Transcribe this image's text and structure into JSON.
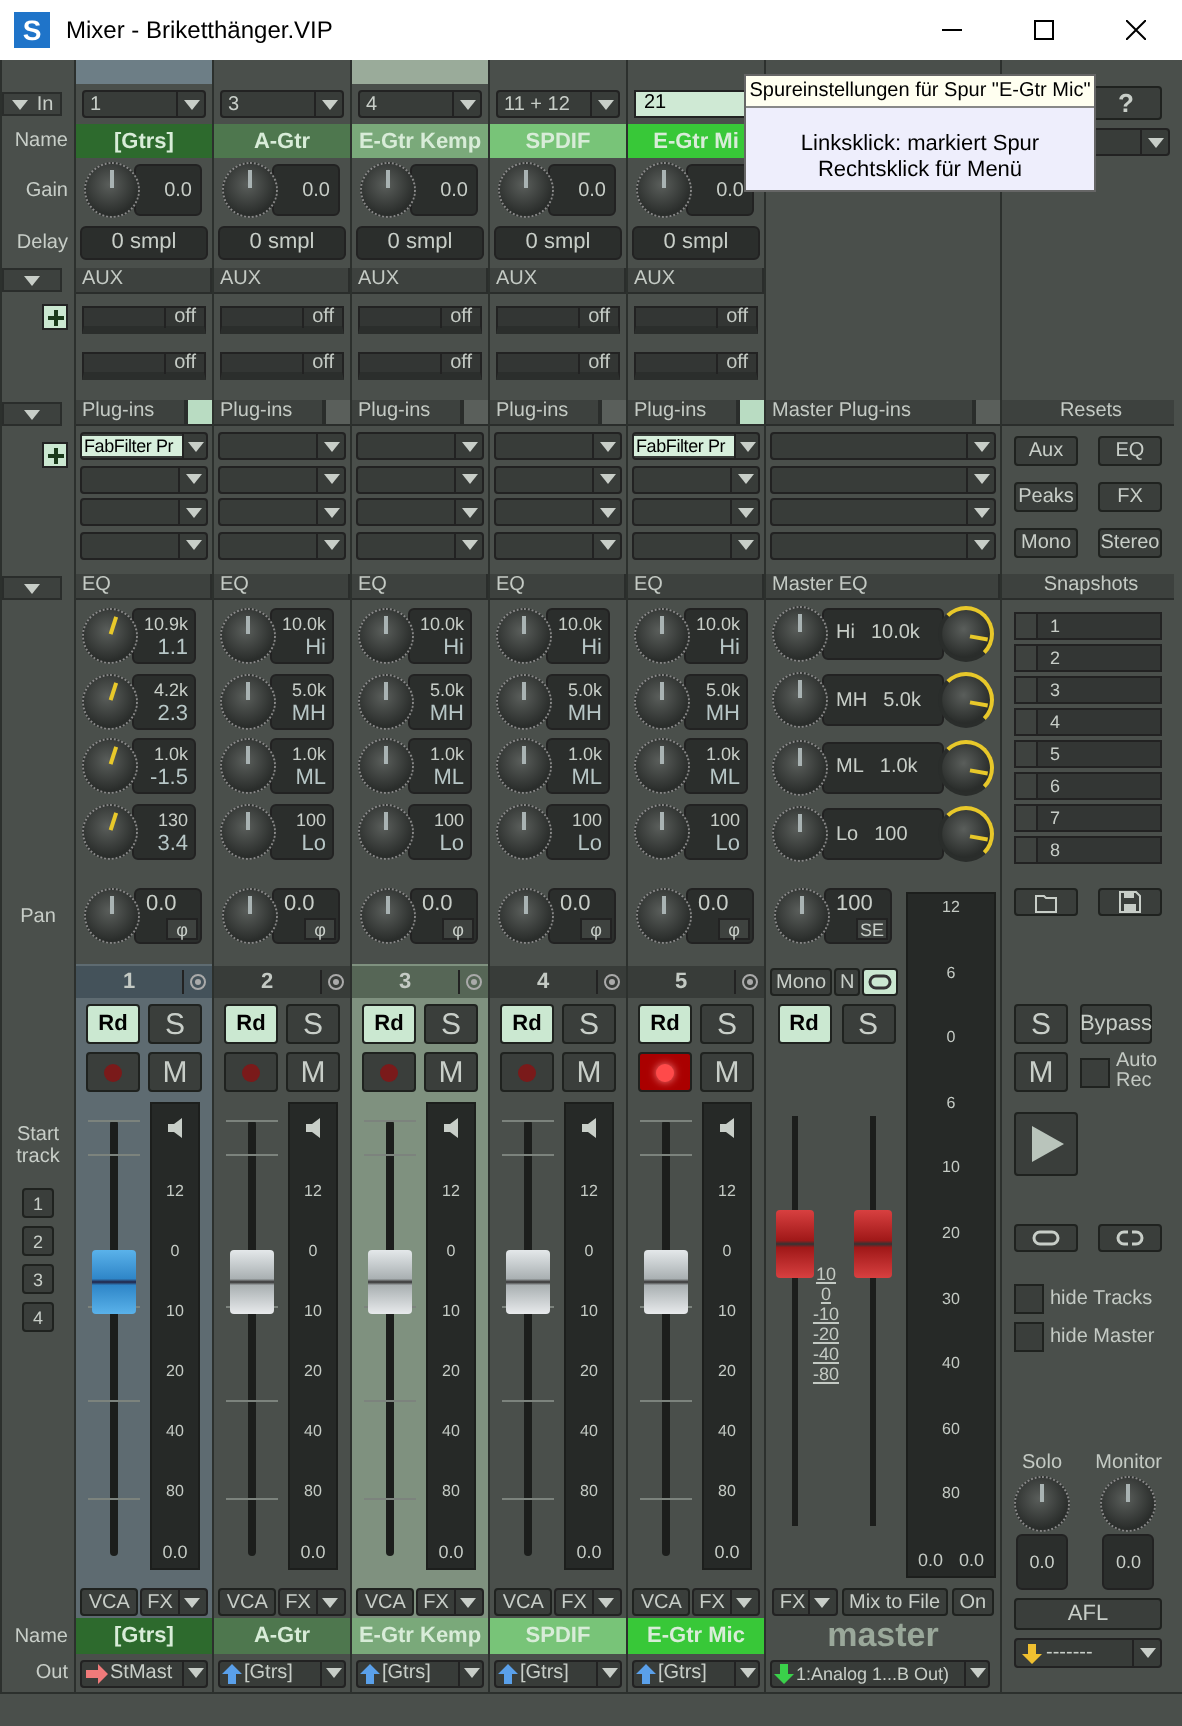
{
  "window": {
    "logo": "S",
    "title": "Mixer - Briketthänger.VIP"
  },
  "row_labels": {
    "in": "In",
    "name": "Name",
    "gain": "Gain",
    "delay": "Delay",
    "pan": "Pan",
    "start_track": "Start track",
    "name_bottom": "Name",
    "out": "Out"
  },
  "start_track_buttons": [
    "1",
    "2",
    "3",
    "4"
  ],
  "channels": [
    {
      "selected": true,
      "hovered": false,
      "input": "1",
      "input_editing": false,
      "name": "[Gtrs]",
      "name_bottom": "[Gtrs]",
      "color": "#2d6a2d",
      "gain": "0.0",
      "delay": "0 smpl",
      "aux_label": "AUX",
      "aux": [
        "off",
        "off"
      ],
      "plugins_label": "Plug-ins",
      "plugins_active": true,
      "plugins": [
        "FabFilter Pr"
      ],
      "eq_label": "EQ",
      "eq": [
        {
          "freq": "10.9k",
          "value": "1.1",
          "active": true
        },
        {
          "freq": "4.2k",
          "value": "2.3",
          "active": true
        },
        {
          "freq": "1.0k",
          "value": "-1.5",
          "active": true
        },
        {
          "freq": "130",
          "value": "3.4",
          "active": true
        }
      ],
      "pan": "0.0",
      "phase": "φ",
      "number": "1",
      "read": "Rd",
      "read_on": true,
      "solo": "S",
      "solo_on": false,
      "rec_armed": false,
      "mute": "M",
      "mute_on": false,
      "level": 0.62,
      "meter_scale": [
        "12",
        "0",
        "10",
        "20",
        "40",
        "80"
      ],
      "meter_value": "0.0",
      "vca": "VCA",
      "fx": "FX",
      "out": {
        "kind": "right",
        "value": "StMast"
      }
    },
    {
      "selected": false,
      "hovered": false,
      "input": "3",
      "input_editing": false,
      "name": "A-Gtr",
      "name_bottom": "A-Gtr",
      "color": "#4e774e",
      "gain": "0.0",
      "delay": "0 smpl",
      "aux_label": "AUX",
      "aux": [
        "off",
        "off"
      ],
      "plugins_label": "Plug-ins",
      "plugins_active": false,
      "eq_label": "EQ",
      "eq": [
        {
          "freq": "10.0k",
          "value": "Hi",
          "active": false
        },
        {
          "freq": "5.0k",
          "value": "MH",
          "active": false
        },
        {
          "freq": "1.0k",
          "value": "ML",
          "active": false
        },
        {
          "freq": "100",
          "value": "Lo",
          "active": false
        }
      ],
      "pan": "0.0",
      "phase": "φ",
      "number": "2",
      "read": "Rd",
      "read_on": true,
      "solo": "S",
      "solo_on": false,
      "rec_armed": false,
      "mute": "M",
      "mute_on": false,
      "level": 0.62,
      "meter_scale": [
        "12",
        "0",
        "10",
        "20",
        "40",
        "80"
      ],
      "meter_value": "0.0",
      "vca": "VCA",
      "fx": "FX",
      "out": {
        "kind": "up",
        "value": "[Gtrs]"
      }
    },
    {
      "selected": false,
      "hovered": true,
      "input": "4",
      "input_editing": false,
      "name": "E-Gtr Kemp",
      "name_bottom": "E-Gtr Kemp",
      "color": "#7aa97a",
      "gain": "0.0",
      "delay": "0 smpl",
      "aux_label": "AUX",
      "aux": [
        "off",
        "off"
      ],
      "plugins_label": "Plug-ins",
      "plugins_active": false,
      "eq_label": "EQ",
      "eq": [
        {
          "freq": "10.0k",
          "value": "Hi",
          "active": false
        },
        {
          "freq": "5.0k",
          "value": "MH",
          "active": false
        },
        {
          "freq": "1.0k",
          "value": "ML",
          "active": false
        },
        {
          "freq": "100",
          "value": "Lo",
          "active": false
        }
      ],
      "pan": "0.0",
      "phase": "φ",
      "number": "3",
      "read": "Rd",
      "read_on": true,
      "solo": "S",
      "solo_on": false,
      "rec_armed": false,
      "mute": "M",
      "mute_on": false,
      "level": 0.62,
      "meter_scale": [
        "12",
        "0",
        "10",
        "20",
        "40",
        "80"
      ],
      "meter_value": "0.0",
      "vca": "VCA",
      "fx": "FX",
      "out": {
        "kind": "up",
        "value": "[Gtrs]"
      }
    },
    {
      "selected": false,
      "hovered": false,
      "input": "11 + 12",
      "input_editing": false,
      "name": "SPDIF",
      "name_bottom": "SPDIF",
      "color": "#78c478",
      "gain": "0.0",
      "delay": "0 smpl",
      "aux_label": "AUX",
      "aux": [
        "off",
        "off"
      ],
      "plugins_label": "Plug-ins",
      "plugins_active": false,
      "eq_label": "EQ",
      "eq": [
        {
          "freq": "10.0k",
          "value": "Hi",
          "active": false
        },
        {
          "freq": "5.0k",
          "value": "MH",
          "active": false
        },
        {
          "freq": "1.0k",
          "value": "ML",
          "active": false
        },
        {
          "freq": "100",
          "value": "Lo",
          "active": false
        }
      ],
      "pan": "0.0",
      "phase": "φ",
      "number": "4",
      "read": "Rd",
      "read_on": true,
      "solo": "S",
      "solo_on": false,
      "rec_armed": false,
      "mute": "M",
      "mute_on": false,
      "level": 0.62,
      "meter_scale": [
        "12",
        "0",
        "10",
        "20",
        "40",
        "80"
      ],
      "meter_value": "0.0",
      "vca": "VCA",
      "fx": "FX",
      "out": {
        "kind": "up",
        "value": "[Gtrs]"
      }
    },
    {
      "selected": false,
      "hovered": false,
      "input": "21",
      "input_editing": true,
      "name": "E-Gtr Mi",
      "name_bottom": "E-Gtr Mic",
      "color": "#38c838",
      "gain": "0.0",
      "delay": "0 smpl",
      "aux_label": "AUX",
      "aux": [
        "off",
        "off"
      ],
      "plugins_label": "Plug-ins",
      "plugins_active": true,
      "plugins": [
        "FabFilter Pr"
      ],
      "eq_label": "EQ",
      "eq": [
        {
          "freq": "10.0k",
          "value": "Hi",
          "active": false
        },
        {
          "freq": "5.0k",
          "value": "MH",
          "active": false
        },
        {
          "freq": "1.0k",
          "value": "ML",
          "active": false
        },
        {
          "freq": "100",
          "value": "Lo",
          "active": false
        }
      ],
      "pan": "0.0",
      "phase": "φ",
      "number": "5",
      "read": "Rd",
      "read_on": true,
      "solo": "S",
      "solo_on": false,
      "rec_armed": true,
      "mute": "M",
      "mute_on": false,
      "level": 0.62,
      "meter_scale": [
        "12",
        "0",
        "10",
        "20",
        "40",
        "80"
      ],
      "meter_value": "0.0",
      "vca": "VCA",
      "fx": "FX",
      "out": {
        "kind": "up",
        "value": "[Gtrs]"
      }
    }
  ],
  "master": {
    "plugins_label": "Master Plug-ins",
    "eq_label": "Master EQ",
    "eq": [
      {
        "band": "Hi",
        "freq": "10.0k"
      },
      {
        "band": "MH",
        "freq": "5.0k"
      },
      {
        "band": "ML",
        "freq": "1.0k"
      },
      {
        "band": "Lo",
        "freq": "100"
      }
    ],
    "pan": "100",
    "pan_mode": "SE",
    "mono": "Mono",
    "n": "N",
    "link_on": true,
    "read": "Rd",
    "read_on": true,
    "solo": "S",
    "solo_on": false,
    "level": 0.7,
    "fader_scale": [
      "10",
      "0",
      "-10",
      "-20",
      "-40",
      "-80"
    ],
    "meter_scale": [
      "12",
      "6",
      "0",
      "6",
      "10",
      "20",
      "30",
      "40",
      "60",
      "80"
    ],
    "meter_values": [
      "0.0",
      "0.0"
    ],
    "fx": "FX",
    "mix_to_file": "Mix to File",
    "on": "On",
    "name": "master",
    "out": {
      "kind": "down",
      "value": "1:Analog 1...B Out)"
    }
  },
  "side": {
    "help": "?",
    "resets_label": "Resets",
    "resets": [
      "Aux",
      "EQ",
      "Peaks",
      "FX",
      "Mono",
      "Stereo"
    ],
    "snapshots_label": "Snapshots",
    "snapshots": [
      "1",
      "2",
      "3",
      "4",
      "5",
      "6",
      "7",
      "8"
    ],
    "solo": "S",
    "bypass": "Bypass",
    "mute": "M",
    "auto_rec": {
      "label": "Auto Rec",
      "checked": false
    },
    "hide_tracks": {
      "label": "hide Tracks",
      "checked": false
    },
    "hide_master": {
      "label": "hide Master",
      "checked": false
    },
    "solo_knob": {
      "label": "Solo",
      "value": "0.0"
    },
    "monitor_knob": {
      "label": "Monitor",
      "value": "0.0"
    },
    "afl": "AFL",
    "out": {
      "kind": "downyellow",
      "value": "-------"
    }
  },
  "tooltip": {
    "title": "Spureinstellungen für Spur \"E-Gtr Mic\"",
    "lines": [
      "Linksklick: markiert Spur",
      "Rechtsklick für Menü"
    ]
  }
}
